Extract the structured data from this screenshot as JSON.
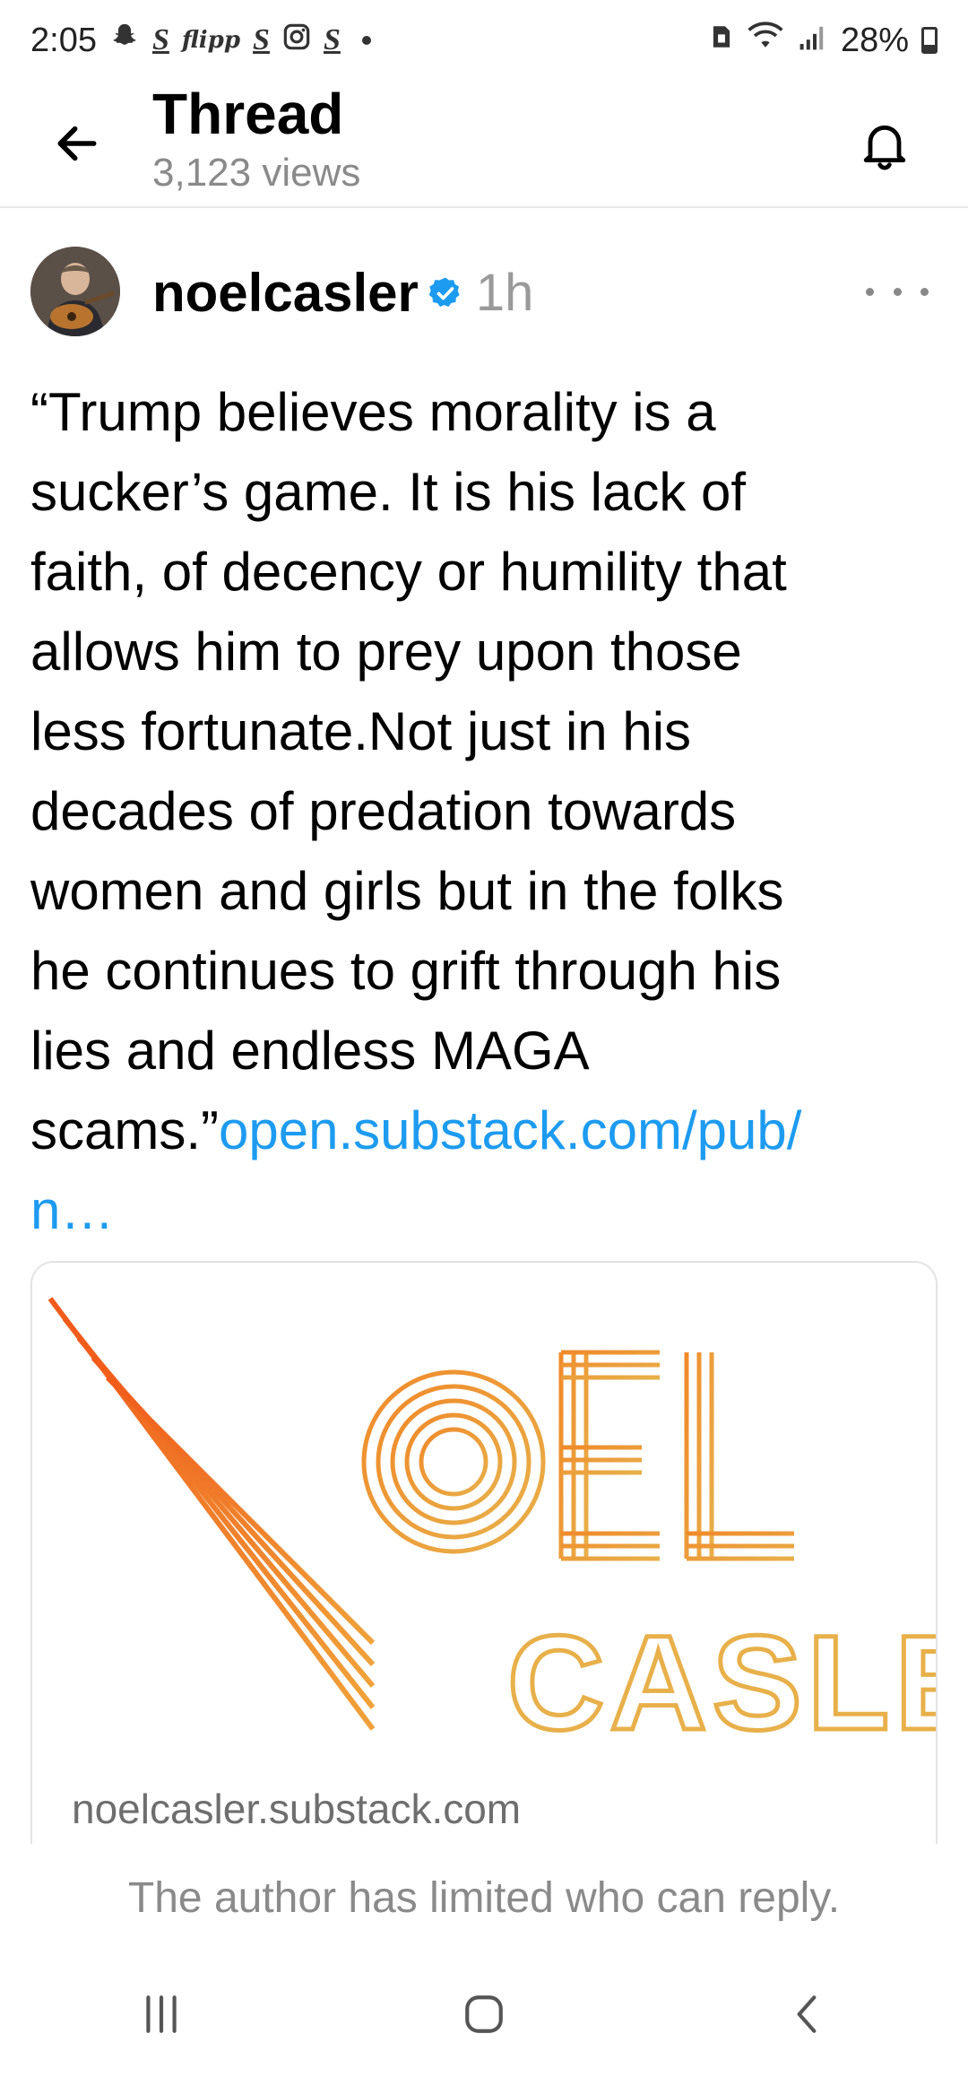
{
  "status_bar": {
    "time": "2:05",
    "battery": "28%",
    "icons": [
      "snapchat-icon",
      "s-app-icon",
      "flipp-icon",
      "s-app-icon",
      "instagram-icon",
      "s-app-icon",
      "notification-dot",
      "sim-icon",
      "wifi-icon",
      "signal-icon",
      "battery-icon"
    ]
  },
  "header": {
    "title": "Thread",
    "subtitle": "3,123 views"
  },
  "post": {
    "username": "noelcasler",
    "timestamp": "1h",
    "text": "“Trump believes morality is a\nsucker’s game. It is his lack of\nfaith, of decency or humility that\nallows him to prey upon those\nless fortunate.Not just in his\ndecades of predation towards\nwomen and girls but in the folks\nhe continues to grift through his\nlies and endless MAGA\nscams.”",
    "link_text": "open.substack.com/pub/\nn…"
  },
  "link_card": {
    "logo_line1": "NOEL",
    "logo_line2": "CASLER",
    "domain": "noelcasler.substack.com"
  },
  "footer": {
    "reply_note": "The author has limited who can reply."
  },
  "colors": {
    "link": "#1d9bf0",
    "verified": "#1d9bf0",
    "logo_orange": "#f06a1a",
    "logo_gold": "#e8b04a"
  }
}
